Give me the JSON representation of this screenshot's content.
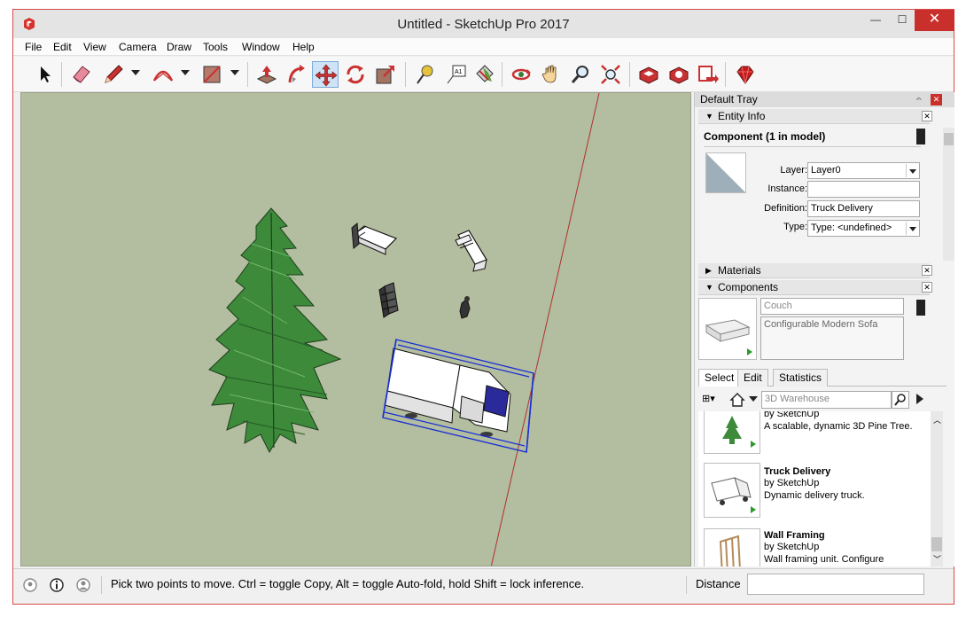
{
  "window": {
    "title": "Untitled - SketchUp Pro 2017",
    "min_glyph": "—",
    "max_glyph": "☐",
    "close_glyph": "✕"
  },
  "menu": [
    "File",
    "Edit",
    "View",
    "Camera",
    "Draw",
    "Tools",
    "Window",
    "Help"
  ],
  "toolbar": {
    "tools": [
      "select-icon",
      "eraser-icon",
      "pencil-icon",
      "arc-icon",
      "rectangle-icon",
      "push-pull-icon",
      "follow-me-icon",
      "move-icon",
      "rotate-icon",
      "scale-icon",
      "tape-measure-icon",
      "text-icon",
      "paint-bucket-icon",
      "orbit-icon",
      "pan-icon",
      "zoom-icon",
      "zoom-extents-icon",
      "3d-warehouse-icon",
      "extension-warehouse-icon",
      "send-to-layout-icon",
      "ruby-icon"
    ],
    "active_tool": "move-icon",
    "text_tool_label": "A1"
  },
  "tray": {
    "title": "Default Tray",
    "pin_glyph": "𝄐",
    "close_glyph": "✕",
    "entity_info": {
      "header": "Entity Info",
      "component_title": "Component (1 in model)",
      "layer_label": "Layer:",
      "layer_value": "Layer0",
      "instance_label": "Instance:",
      "instance_value": "",
      "definition_label": "Definition:",
      "definition_value": "Truck Delivery",
      "type_label": "Type:",
      "type_value": "Type: <undefined>"
    },
    "materials": {
      "header": "Materials"
    },
    "components": {
      "header": "Components",
      "name_field": "Couch",
      "description_field": "Configurable Modern Sofa",
      "tabs": [
        "Select",
        "Edit",
        "Statistics"
      ],
      "active_tab": "Select",
      "search_placeholder": "3D Warehouse",
      "items": [
        {
          "name": "",
          "author": "by SketchUp",
          "description": "A scalable, dynamic 3D Pine Tree."
        },
        {
          "name": "Truck Delivery",
          "author": "by SketchUp",
          "description": "Dynamic delivery truck."
        },
        {
          "name": "Wall Framing",
          "author": "by SketchUp",
          "description": "Wall framing unit.  Configure manually using the component opt..."
        }
      ]
    }
  },
  "status": {
    "message": "Pick two points to move.  Ctrl = toggle Copy, Alt = toggle Auto-fold, hold Shift = lock inference.",
    "distance_label": "Distance",
    "distance_value": ""
  },
  "colors": {
    "viewport_bg": "#b3bd9f",
    "selection_blue": "#1a2fd6",
    "tree_green": "#3c8a3a",
    "axis_red": "#b03030",
    "close_red": "#c9302c"
  }
}
